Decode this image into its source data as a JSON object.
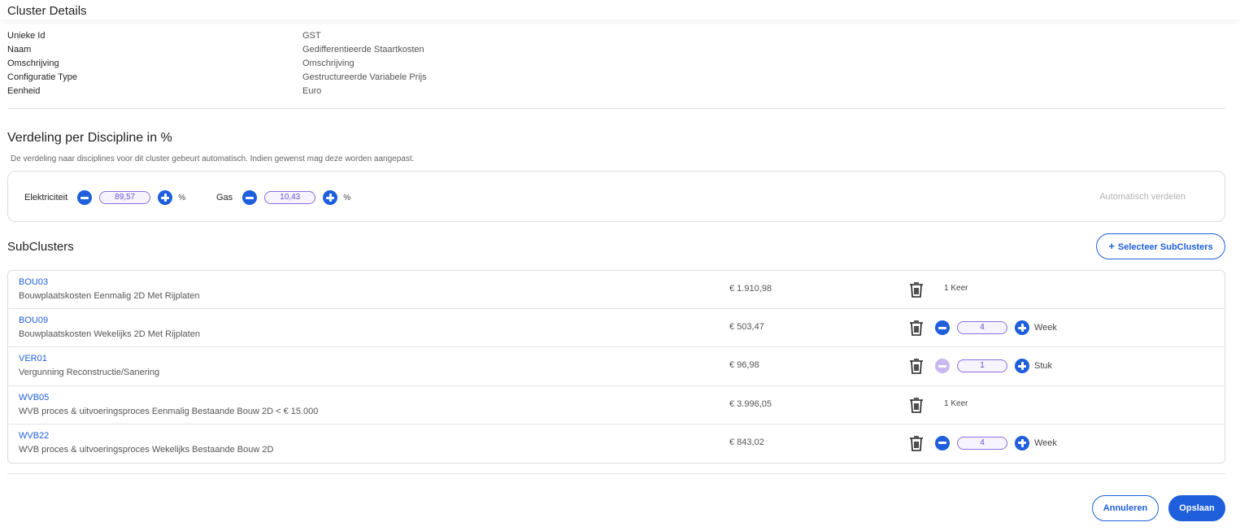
{
  "header": {
    "title": "Cluster Details"
  },
  "details": [
    {
      "label": "Unieke Id",
      "value": "GST"
    },
    {
      "label": "Naam",
      "value": "Gedifferentieerde Staartkosten"
    },
    {
      "label": "Omschrijving",
      "value": "Omschrijving"
    },
    {
      "label": "Configuratie Type",
      "value": "Gestructureerde Variabele Prijs"
    },
    {
      "label": "Eenheid",
      "value": "Euro"
    }
  ],
  "distribution": {
    "title": "Verdeling per Discipline in %",
    "description": "De verdeling naar disciplines voor dit cluster gebeurt automatisch. Indien gewenst mag deze worden aangepast.",
    "items": [
      {
        "label": "Elektriciteit",
        "value": "89,57",
        "unit": "%"
      },
      {
        "label": "Gas",
        "value": "10,43",
        "unit": "%"
      }
    ],
    "auto_label": "Automatisch verdelen"
  },
  "subclusters": {
    "title": "SubClusters",
    "select_label": "Selecteer SubClusters",
    "rows": [
      {
        "code": "BOU03",
        "description": "Bouwplaatskosten Eenmalig 2D Met Rijplaten",
        "price": "€ 1.910,98",
        "quantity_text": "1 Keer"
      },
      {
        "code": "BOU09",
        "description": "Bouwplaatskosten Wekelijks 2D Met Rijplaten",
        "price": "€ 503,47",
        "quantity": "4",
        "unit": "Week"
      },
      {
        "code": "VER01",
        "description": "Vergunning Reconstructie/Sanering",
        "price": "€ 96,98",
        "quantity": "1",
        "unit": "Stuk"
      },
      {
        "code": "WVB05",
        "description": "WVB proces & uitvoeringsproces Eenmalig Bestaande Bouw 2D < € 15.000",
        "price": "€ 3.996,05",
        "quantity_text": "1 Keer"
      },
      {
        "code": "WVB22",
        "description": "WVB proces & uitvoeringsproces Wekelijks Bestaande Bouw 2D",
        "price": "€ 843,02",
        "quantity": "4",
        "unit": "Week"
      }
    ]
  },
  "footer": {
    "cancel_label": "Annuleren",
    "save_label": "Opslaan"
  },
  "colors": {
    "accent": "#1f5fdc",
    "pill_text": "#6b4fd3",
    "disabled": "#c9b8f0"
  }
}
